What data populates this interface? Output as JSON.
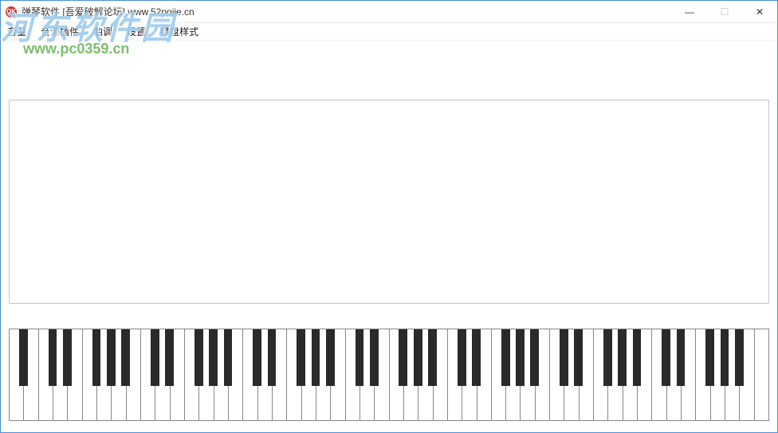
{
  "titlebar": {
    "icon_label": "OK",
    "title": "弹琴软件 [吾爱破解论坛] www.52pojie.cn"
  },
  "menu": {
    "items": [
      "音量",
      "音源插件",
      "曲调",
      "设置",
      "键盘样式"
    ]
  },
  "watermark": {
    "brand": "河东软件园",
    "url": "www.pc0359.cn"
  },
  "piano": {
    "white_key_count": 52,
    "black_pattern": [
      1,
      0,
      1,
      1,
      0,
      1,
      1
    ]
  },
  "window_controls": {
    "minimize": "—",
    "maximize": "☐",
    "close": "✕"
  }
}
